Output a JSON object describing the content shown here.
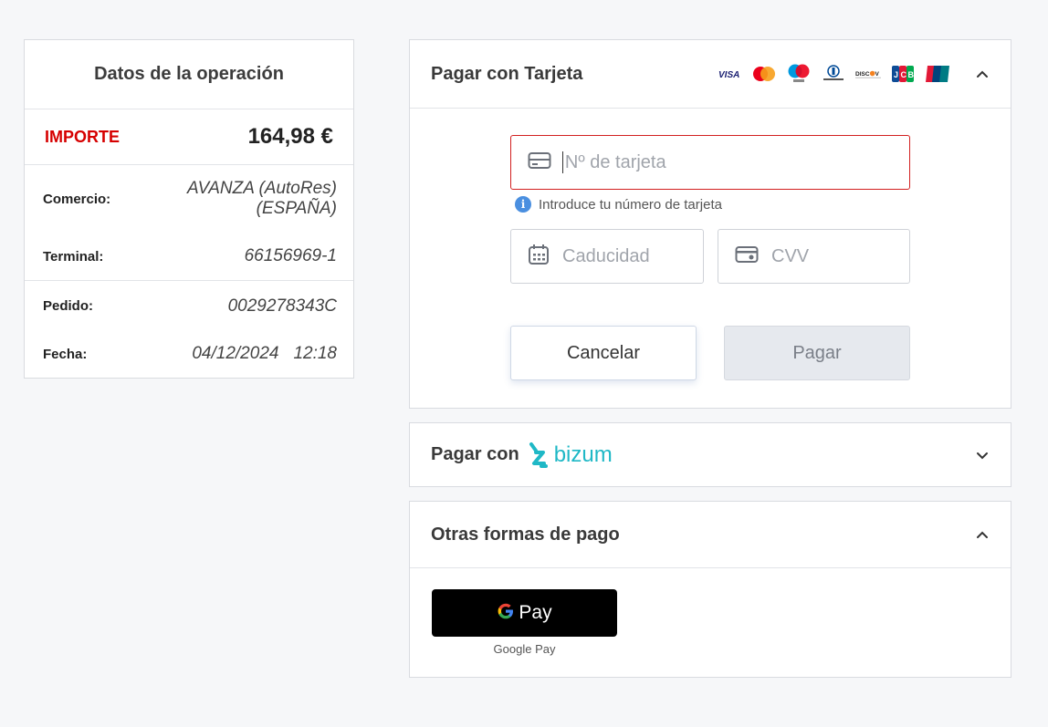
{
  "operation": {
    "title": "Datos de la operación",
    "amount_label": "IMPORTE",
    "amount_value": "164,98 €",
    "comercio_label": "Comercio:",
    "comercio_value_1": "AVANZA (AutoRes)",
    "comercio_value_2": "(ESPAÑA)",
    "terminal_label": "Terminal:",
    "terminal_value": "66156969-1",
    "pedido_label": "Pedido:",
    "pedido_value": "0029278343C",
    "fecha_label": "Fecha:",
    "fecha_date": "04/12/2024",
    "fecha_time": "12:18"
  },
  "card": {
    "title": "Pagar con Tarjeta",
    "brands": [
      "VISA",
      "Mastercard",
      "Maestro",
      "Diners Club",
      "DISCOVER",
      "JCB",
      "UnionPay"
    ],
    "number_placeholder": "Nº de tarjeta",
    "number_hint": "Introduce tu número de tarjeta",
    "expiry_placeholder": "Caducidad",
    "cvv_placeholder": "CVV",
    "cancel_label": "Cancelar",
    "pay_label": "Pagar"
  },
  "bizum": {
    "title": "Pagar con",
    "brand": "bizum"
  },
  "other": {
    "title": "Otras formas de pago",
    "gpay_label": "Pay",
    "gpay_caption": "Google Pay"
  },
  "colors": {
    "accent_red": "#d60000",
    "error_border": "#d21f1f",
    "bizum": "#1fb8c6",
    "info": "#4a8fe0"
  }
}
